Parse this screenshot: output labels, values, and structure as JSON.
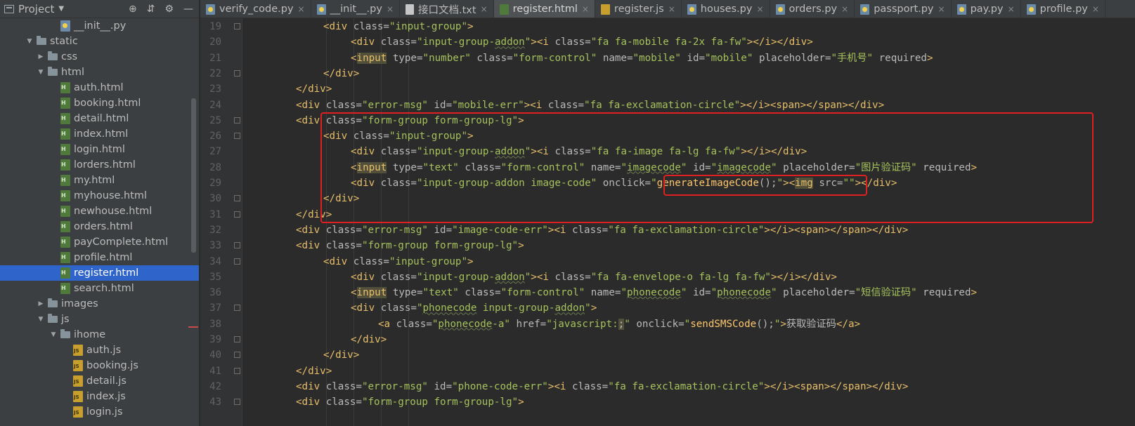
{
  "sidebar": {
    "title": "Project",
    "tools": {
      "locate": "⊕",
      "collapse": "⇵",
      "settings": "⚙",
      "hide": "—"
    },
    "tree": [
      {
        "label": "__init__.py",
        "type": "py",
        "depth": 4,
        "arrow": ""
      },
      {
        "label": "static",
        "type": "folder",
        "depth": 2,
        "arrow": "▼"
      },
      {
        "label": "css",
        "type": "folder",
        "depth": 3,
        "arrow": "▶"
      },
      {
        "label": "html",
        "type": "folder",
        "depth": 3,
        "arrow": "▼"
      },
      {
        "label": "auth.html",
        "type": "html",
        "depth": 4,
        "arrow": ""
      },
      {
        "label": "booking.html",
        "type": "html",
        "depth": 4,
        "arrow": ""
      },
      {
        "label": "detail.html",
        "type": "html",
        "depth": 4,
        "arrow": ""
      },
      {
        "label": "index.html",
        "type": "html",
        "depth": 4,
        "arrow": ""
      },
      {
        "label": "login.html",
        "type": "html",
        "depth": 4,
        "arrow": ""
      },
      {
        "label": "lorders.html",
        "type": "html",
        "depth": 4,
        "arrow": ""
      },
      {
        "label": "my.html",
        "type": "html",
        "depth": 4,
        "arrow": ""
      },
      {
        "label": "myhouse.html",
        "type": "html",
        "depth": 4,
        "arrow": ""
      },
      {
        "label": "newhouse.html",
        "type": "html",
        "depth": 4,
        "arrow": ""
      },
      {
        "label": "orders.html",
        "type": "html",
        "depth": 4,
        "arrow": ""
      },
      {
        "label": "payComplete.html",
        "type": "html",
        "depth": 4,
        "arrow": ""
      },
      {
        "label": "profile.html",
        "type": "html",
        "depth": 4,
        "arrow": ""
      },
      {
        "label": "register.html",
        "type": "html",
        "depth": 4,
        "arrow": "",
        "selected": true
      },
      {
        "label": "search.html",
        "type": "html",
        "depth": 4,
        "arrow": ""
      },
      {
        "label": "images",
        "type": "folder",
        "depth": 3,
        "arrow": "▶"
      },
      {
        "label": "js",
        "type": "folder",
        "depth": 3,
        "arrow": "▼"
      },
      {
        "label": "ihome",
        "type": "folder",
        "depth": 4,
        "arrow": "▼"
      },
      {
        "label": "auth.js",
        "type": "js",
        "depth": 5,
        "arrow": ""
      },
      {
        "label": "booking.js",
        "type": "js",
        "depth": 5,
        "arrow": ""
      },
      {
        "label": "detail.js",
        "type": "js",
        "depth": 5,
        "arrow": ""
      },
      {
        "label": "index.js",
        "type": "js",
        "depth": 5,
        "arrow": ""
      },
      {
        "label": "login.js",
        "type": "js",
        "depth": 5,
        "arrow": ""
      }
    ]
  },
  "tabs": [
    {
      "label": "verify_code.py",
      "icon": "python-file-icon"
    },
    {
      "label": "__init__.py",
      "icon": "python-file-icon"
    },
    {
      "label": "接口文档.txt",
      "icon": "text-file-icon"
    },
    {
      "label": "register.html",
      "icon": "html-file-icon",
      "active": true
    },
    {
      "label": "register.js",
      "icon": "js-file-icon"
    },
    {
      "label": "houses.py",
      "icon": "python-file-icon"
    },
    {
      "label": "orders.py",
      "icon": "python-file-icon"
    },
    {
      "label": "passport.py",
      "icon": "python-file-icon"
    },
    {
      "label": "pay.py",
      "icon": "python-file-icon"
    },
    {
      "label": "profile.py",
      "icon": "python-file-icon"
    }
  ],
  "editor": {
    "first_line": 19,
    "lines": [
      {
        "n": "19",
        "indent": 3,
        "segs": [
          [
            "t",
            "<div "
          ],
          [
            "a",
            "class="
          ],
          [
            "v",
            "\"input-group\""
          ],
          [
            "t",
            ">"
          ]
        ]
      },
      {
        "n": "20",
        "indent": 4,
        "segs": [
          [
            "t",
            "<div "
          ],
          [
            "a",
            "class="
          ],
          [
            "v",
            "\"input-group-"
          ],
          [
            "vs",
            "addon"
          ],
          [
            "v",
            "\""
          ],
          [
            "t",
            "><i "
          ],
          [
            "a",
            "class="
          ],
          [
            "v",
            "\"fa fa-mobile fa-2x fa-fw\""
          ],
          [
            "t",
            "></i></div>"
          ]
        ]
      },
      {
        "n": "21",
        "indent": 4,
        "segs": [
          [
            "t",
            "<"
          ],
          [
            "th",
            "input"
          ],
          [
            "t",
            " "
          ],
          [
            "a",
            "type="
          ],
          [
            "v",
            "\"number\""
          ],
          [
            "t",
            " "
          ],
          [
            "a",
            "class="
          ],
          [
            "v",
            "\"form-control\""
          ],
          [
            "t",
            " "
          ],
          [
            "a",
            "name="
          ],
          [
            "v",
            "\"mobile\""
          ],
          [
            "t",
            " "
          ],
          [
            "a",
            "id="
          ],
          [
            "v",
            "\"mobile\""
          ],
          [
            "t",
            " "
          ],
          [
            "a",
            "placeholder="
          ],
          [
            "v",
            "\"手机号\""
          ],
          [
            "t",
            " "
          ],
          [
            "a",
            "required"
          ],
          [
            "t",
            ">"
          ]
        ]
      },
      {
        "n": "22",
        "indent": 3,
        "segs": [
          [
            "t",
            "</div>"
          ]
        ]
      },
      {
        "n": "23",
        "indent": 2,
        "segs": [
          [
            "t",
            "</div>"
          ]
        ]
      },
      {
        "n": "24",
        "indent": 2,
        "segs": [
          [
            "t",
            "<div "
          ],
          [
            "a",
            "class="
          ],
          [
            "v",
            "\"error-msg\""
          ],
          [
            "t",
            " "
          ],
          [
            "a",
            "id="
          ],
          [
            "v",
            "\"mobile-err\""
          ],
          [
            "t",
            "><i "
          ],
          [
            "a",
            "class="
          ],
          [
            "v",
            "\"fa fa-exclamation-circle\""
          ],
          [
            "t",
            "></i><span></span></div>"
          ]
        ]
      },
      {
        "n": "25",
        "indent": 2,
        "segs": [
          [
            "t",
            "<div "
          ],
          [
            "a",
            "class="
          ],
          [
            "v",
            "\"form-group form-group-lg\""
          ],
          [
            "t",
            ">"
          ]
        ]
      },
      {
        "n": "26",
        "indent": 3,
        "segs": [
          [
            "t",
            "<div "
          ],
          [
            "a",
            "class="
          ],
          [
            "v",
            "\"input-group\""
          ],
          [
            "t",
            ">"
          ]
        ]
      },
      {
        "n": "27",
        "indent": 4,
        "segs": [
          [
            "t",
            "<div "
          ],
          [
            "a",
            "class="
          ],
          [
            "v",
            "\"input-group-"
          ],
          [
            "vs",
            "addon"
          ],
          [
            "v",
            "\""
          ],
          [
            "t",
            "><i "
          ],
          [
            "a",
            "class="
          ],
          [
            "v",
            "\"fa fa-image fa-lg fa-fw\""
          ],
          [
            "t",
            "></i></div>"
          ]
        ]
      },
      {
        "n": "28",
        "indent": 4,
        "segs": [
          [
            "t",
            "<"
          ],
          [
            "th",
            "input"
          ],
          [
            "t",
            " "
          ],
          [
            "a",
            "type="
          ],
          [
            "v",
            "\"text\""
          ],
          [
            "t",
            " "
          ],
          [
            "a",
            "class="
          ],
          [
            "v",
            "\"form-control\""
          ],
          [
            "t",
            " "
          ],
          [
            "a",
            "name="
          ],
          [
            "v",
            "\""
          ],
          [
            "vs",
            "imagecode"
          ],
          [
            "v",
            "\""
          ],
          [
            "t",
            " "
          ],
          [
            "a",
            "id="
          ],
          [
            "v",
            "\""
          ],
          [
            "vs",
            "imagecode"
          ],
          [
            "v",
            "\""
          ],
          [
            "t",
            " "
          ],
          [
            "a",
            "placeholder="
          ],
          [
            "v",
            "\"图片验证码\""
          ],
          [
            "t",
            " "
          ],
          [
            "a",
            "required"
          ],
          [
            "t",
            ">"
          ]
        ]
      },
      {
        "n": "29",
        "indent": 4,
        "segs": [
          [
            "t",
            "<div "
          ],
          [
            "a",
            "class="
          ],
          [
            "v",
            "\"input-group-addon image-code\""
          ],
          [
            "t",
            " "
          ],
          [
            "a",
            "onclick="
          ],
          [
            "v",
            "\""
          ],
          [
            "f",
            "generateImageCode"
          ],
          [
            "a",
            "();"
          ],
          [
            "v",
            "\""
          ],
          [
            "t",
            "><"
          ],
          [
            "th",
            "img"
          ],
          [
            "t",
            " "
          ],
          [
            "a",
            "src="
          ],
          [
            "v",
            "\"\""
          ],
          [
            "t",
            "></div>"
          ]
        ]
      },
      {
        "n": "30",
        "indent": 3,
        "segs": [
          [
            "t",
            "</div>"
          ]
        ]
      },
      {
        "n": "31",
        "indent": 2,
        "segs": [
          [
            "t",
            "</div>"
          ]
        ]
      },
      {
        "n": "32",
        "indent": 2,
        "segs": [
          [
            "t",
            "<div "
          ],
          [
            "a",
            "class="
          ],
          [
            "v",
            "\"error-msg\""
          ],
          [
            "t",
            " "
          ],
          [
            "a",
            "id="
          ],
          [
            "v",
            "\"image-code-err\""
          ],
          [
            "t",
            "><i "
          ],
          [
            "a",
            "class="
          ],
          [
            "v",
            "\"fa fa-exclamation-circle\""
          ],
          [
            "t",
            "></i><span></span></div>"
          ]
        ]
      },
      {
        "n": "33",
        "indent": 2,
        "segs": [
          [
            "t",
            "<div "
          ],
          [
            "a",
            "class="
          ],
          [
            "v",
            "\"form-group form-group-lg\""
          ],
          [
            "t",
            ">"
          ]
        ]
      },
      {
        "n": "34",
        "indent": 3,
        "segs": [
          [
            "t",
            "<div "
          ],
          [
            "a",
            "class="
          ],
          [
            "v",
            "\"input-group\""
          ],
          [
            "t",
            ">"
          ]
        ]
      },
      {
        "n": "35",
        "indent": 4,
        "segs": [
          [
            "t",
            "<div "
          ],
          [
            "a",
            "class="
          ],
          [
            "v",
            "\"input-group-"
          ],
          [
            "vs",
            "addon"
          ],
          [
            "v",
            "\""
          ],
          [
            "t",
            "><i "
          ],
          [
            "a",
            "class="
          ],
          [
            "v",
            "\"fa fa-envelope-o fa-lg fa-fw\""
          ],
          [
            "t",
            "></i></div>"
          ]
        ]
      },
      {
        "n": "36",
        "indent": 4,
        "segs": [
          [
            "t",
            "<"
          ],
          [
            "th",
            "input"
          ],
          [
            "t",
            " "
          ],
          [
            "a",
            "type="
          ],
          [
            "v",
            "\"text\""
          ],
          [
            "t",
            " "
          ],
          [
            "a",
            "class="
          ],
          [
            "v",
            "\"form-control\""
          ],
          [
            "t",
            " "
          ],
          [
            "a",
            "name="
          ],
          [
            "v",
            "\""
          ],
          [
            "vs",
            "phonecode"
          ],
          [
            "v",
            "\""
          ],
          [
            "t",
            " "
          ],
          [
            "a",
            "id="
          ],
          [
            "v",
            "\""
          ],
          [
            "vs",
            "phonecode"
          ],
          [
            "v",
            "\""
          ],
          [
            "t",
            " "
          ],
          [
            "a",
            "placeholder="
          ],
          [
            "v",
            "\"短信验证码\""
          ],
          [
            "t",
            " "
          ],
          [
            "a",
            "required"
          ],
          [
            "t",
            ">"
          ]
        ]
      },
      {
        "n": "37",
        "indent": 4,
        "segs": [
          [
            "t",
            "<div "
          ],
          [
            "a",
            "class="
          ],
          [
            "v",
            "\""
          ],
          [
            "vs",
            "phonecode"
          ],
          [
            "v",
            " input-group-"
          ],
          [
            "vs",
            "addon"
          ],
          [
            "v",
            "\""
          ],
          [
            "t",
            ">"
          ]
        ]
      },
      {
        "n": "38",
        "indent": 5,
        "segs": [
          [
            "t",
            "<a "
          ],
          [
            "a",
            "class="
          ],
          [
            "v",
            "\""
          ],
          [
            "vs",
            "phonecode"
          ],
          [
            "v",
            "-a\""
          ],
          [
            "t",
            " "
          ],
          [
            "a",
            "href="
          ],
          [
            "v",
            "\"javascript:"
          ],
          [
            "ah",
            ";"
          ],
          [
            "v",
            "\""
          ],
          [
            "t",
            " "
          ],
          [
            "a",
            "onclick="
          ],
          [
            "v",
            "\""
          ],
          [
            "f",
            "sendSMSCode"
          ],
          [
            "a",
            "();"
          ],
          [
            "v",
            "\""
          ],
          [
            "t",
            ">"
          ],
          [
            "a",
            "获取验证码"
          ],
          [
            "t",
            "</a>"
          ]
        ]
      },
      {
        "n": "39",
        "indent": 4,
        "segs": [
          [
            "t",
            "</div>"
          ]
        ]
      },
      {
        "n": "40",
        "indent": 3,
        "segs": [
          [
            "t",
            "</div>"
          ]
        ]
      },
      {
        "n": "41",
        "indent": 2,
        "segs": [
          [
            "t",
            "</div>"
          ]
        ]
      },
      {
        "n": "42",
        "indent": 2,
        "segs": [
          [
            "t",
            "<div "
          ],
          [
            "a",
            "class="
          ],
          [
            "v",
            "\"error-msg\""
          ],
          [
            "t",
            " "
          ],
          [
            "a",
            "id="
          ],
          [
            "v",
            "\"phone-code-err\""
          ],
          [
            "t",
            "><i "
          ],
          [
            "a",
            "class="
          ],
          [
            "v",
            "\"fa fa-exclamation-circle\""
          ],
          [
            "t",
            "></i><span></span></div>"
          ]
        ]
      },
      {
        "n": "43",
        "indent": 2,
        "segs": [
          [
            "t",
            "<div "
          ],
          [
            "a",
            "class="
          ],
          [
            "v",
            "\"form-group form-group-lg\""
          ],
          [
            "t",
            ">"
          ]
        ]
      }
    ]
  },
  "colors": {
    "tag": "#e8bf6a",
    "attribute": "#bababa",
    "value": "#a5c25c",
    "highlight_box": "#e02020",
    "selection": "#2f65ca"
  }
}
